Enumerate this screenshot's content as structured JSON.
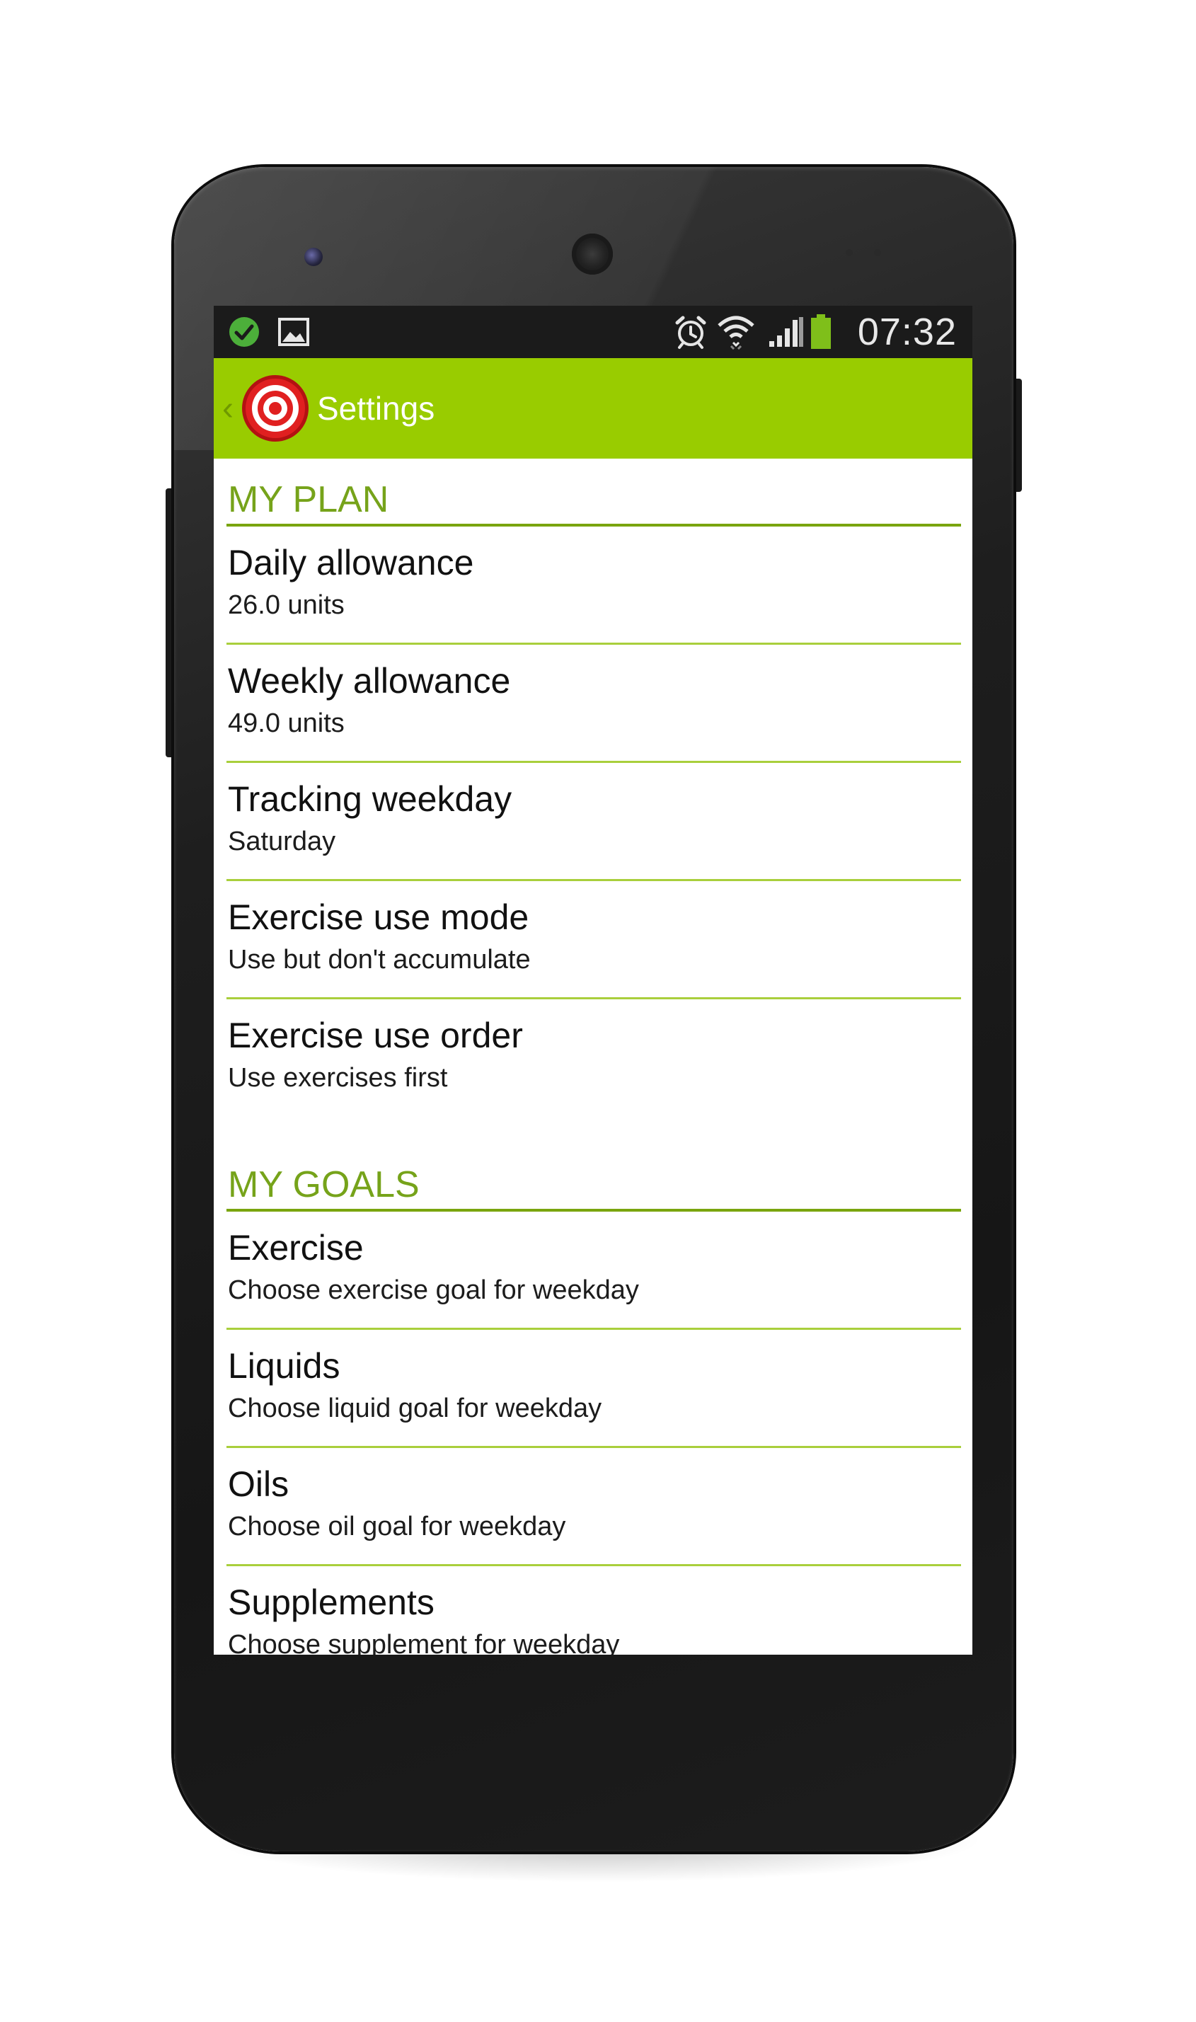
{
  "status_bar": {
    "time": "07:32",
    "left_icons": [
      "check-circle-icon",
      "image-icon"
    ],
    "right_icons": [
      "alarm-icon",
      "wifi-icon",
      "signal-icon",
      "battery-icon"
    ]
  },
  "action_bar": {
    "title": "Settings",
    "up_caret": "‹",
    "logo": "target-icon",
    "color": "#99cc00"
  },
  "sections": [
    {
      "header": "MY PLAN",
      "items": [
        {
          "title": "Daily allowance",
          "summary": "26.0 units"
        },
        {
          "title": "Weekly allowance",
          "summary": "49.0 units"
        },
        {
          "title": "Tracking weekday",
          "summary": "Saturday"
        },
        {
          "title": "Exercise use mode",
          "summary": "Use but don't accumulate"
        },
        {
          "title": "Exercise use order",
          "summary": "Use exercises first"
        }
      ]
    },
    {
      "header": "MY GOALS",
      "items": [
        {
          "title": "Exercise",
          "summary": "Choose exercise goal for weekday"
        },
        {
          "title": "Liquids",
          "summary": "Choose liquid goal for weekday"
        },
        {
          "title": "Oils",
          "summary": "Choose oil goal for weekday"
        },
        {
          "title": "Supplements",
          "summary": "Choose supplement for weekday"
        }
      ]
    }
  ],
  "colors": {
    "accent_green": "#99cc00",
    "section_header_text": "#76a31a",
    "divider": "#a9cf3c"
  }
}
